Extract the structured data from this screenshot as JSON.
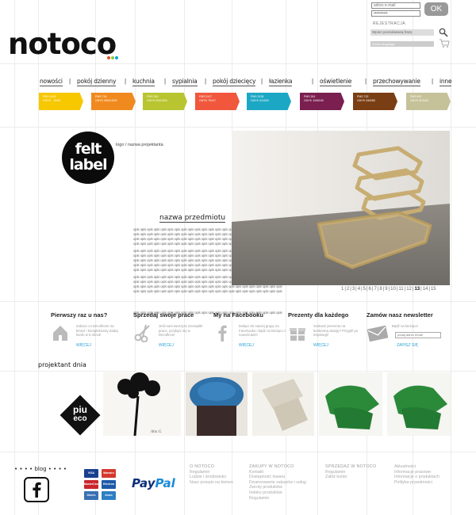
{
  "header": {
    "email_placeholder": "adres e-mail",
    "password_value": "**********",
    "ok_label": "OK",
    "register_label": "REJESTRACJA",
    "search_placeholder": "Wpisz poszukiwaną frazę",
    "lang_label": "Select language"
  },
  "logo": {
    "text": "notoco",
    "dot_colors": [
      "#e84e1b",
      "#8dc63f",
      "#00a7d8"
    ]
  },
  "nav": {
    "items": [
      "nowości",
      "pokój dzienny",
      "kuchnia",
      "sypialnia",
      "pokój dziecięcy",
      "łazienka",
      "oświetlenie",
      "przechowywanie",
      "inne"
    ],
    "swatches": [
      {
        "code": "PMS 1405",
        "sub": "CMYK · 100M",
        "color": "#f7c700"
      },
      {
        "code": "PMS 716",
        "sub": "CMYK 0/60/100/0",
        "color": "#f08a1f"
      },
      {
        "code": "PMS 390",
        "sub": "CMYK 0/0/100/0",
        "color": "#b8c530"
      },
      {
        "code": "PMS 2417",
        "sub": "CMYK 79/47/",
        "color": "#f0573c"
      },
      {
        "code": "PMS 3135",
        "sub": "CMYK 0/100/0",
        "color": "#1ca8c4"
      },
      {
        "code": "PMS 261",
        "sub": "CMYK 10/60/40",
        "color": "#7a1f4f"
      },
      {
        "code": "PMS 732",
        "sub": "CMYK 0/60/80",
        "color": "#7a3e14"
      },
      {
        "code": "PMS 451",
        "sub": "CMYK 5/10/40",
        "color": "#c5c29a"
      }
    ]
  },
  "hero": {
    "designer_logo_top": "felt",
    "designer_logo_bottom": "label",
    "designer_caption": "logo / nazwa projektanta",
    "product_name": "nazwa przedmiotu",
    "lorem_word": "opis",
    "pager_pages": [
      "1",
      "2",
      "3",
      "4",
      "5",
      "6",
      "7",
      "8",
      "9",
      "10",
      "11",
      "12",
      "13",
      "14",
      "15"
    ],
    "pager_current": "13"
  },
  "info_boxes": [
    {
      "title": "Pierwszy raz u nas?",
      "text": "Zobacz co Decoflezer na któryś i kompleksowy Zadaj konto w 5 minut!",
      "link": "WIĘCEJ",
      "icon": "house-icon"
    },
    {
      "title": "Sprzedaj swoje prace",
      "text": "Jeśli sam tworzysz niezwykłe prace, przyłącz się w Decoflezer",
      "link": "WIĘCEJ",
      "icon": "scissors-icon"
    },
    {
      "title": "My na Facebooku",
      "text": "Dołącz do naszej grupy na Facebooku i bądź na bieżąco z nowościami!",
      "link": "WIĘCEJ",
      "icon": "facebook-icon"
    },
    {
      "title": "Prezenty dla każdego",
      "text": "Szukasz prezentu na konkretną okazję? Przyjdź po inspirację!",
      "link": "WIĘCEJ",
      "icon": "gift-icon"
    },
    {
      "title": "Zamów nasz newsletter",
      "text": "Bądź na bieżąco!",
      "input_placeholder": "podaj adres email",
      "link": "ZAPISZ SIĘ",
      "icon": "envelope-icon"
    }
  ],
  "designer_of_day": {
    "title": "projektant dnia",
    "logo_top": "piu",
    "logo_bottom": "eco"
  },
  "footer": {
    "blog_label": "blog",
    "columns": [
      {
        "heading": "O NOTOCO",
        "items": [
          "Regulamin",
          "Ludzie i środowisko",
          "Nasz przepis na biznes"
        ]
      },
      {
        "heading": "ZAKUPY W NOTOCO",
        "items": [
          "Kontakt",
          "Dostępność towaru",
          "Finansowanie zakupów i usług",
          "Zwroty produktów",
          "Indeks produktów",
          "Regulamin"
        ]
      },
      {
        "heading": "SPRZEDAŻ W NOTOCO",
        "items": [
          "Regulamin",
          "Załóż konto"
        ]
      },
      {
        "heading": "",
        "items": [
          "Aktualności",
          "Informacje prasowe",
          "Informacje o produktach",
          "Polityka prywatności"
        ]
      }
    ],
    "payment_cards": [
      "VISA",
      "Maestro",
      "MasterCard",
      "Electron",
      "Diners",
      "Amex"
    ],
    "paypal_a": "Pay",
    "paypal_b": "Pal"
  }
}
